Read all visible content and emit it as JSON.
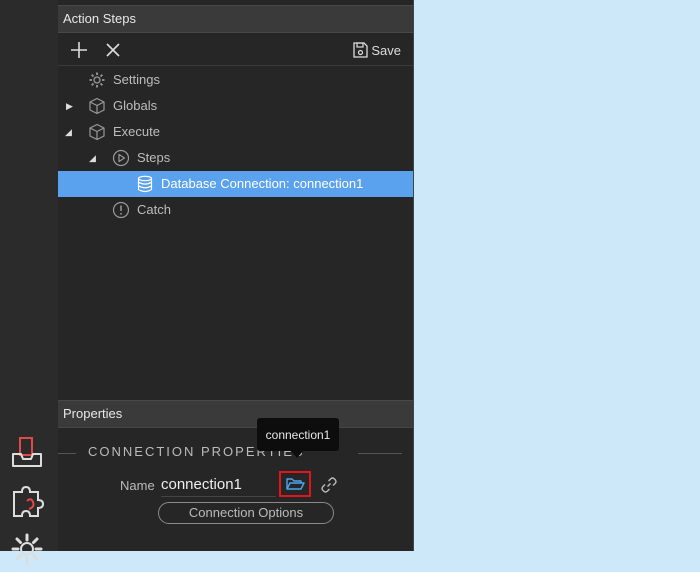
{
  "action_steps_panel": {
    "title": "Action Steps",
    "toolbar": {
      "add_icon": "plus-icon",
      "remove_icon": "close-icon",
      "save_label": "Save"
    },
    "tree": [
      {
        "label": "Settings",
        "icon": "gear-icon",
        "expander": ""
      },
      {
        "label": "Globals",
        "icon": "cube-icon",
        "expander": "▶"
      },
      {
        "label": "Execute",
        "icon": "cube-icon",
        "expander": "◢"
      },
      {
        "label": "Steps",
        "icon": "play-circle-icon",
        "expander": "◢"
      },
      {
        "label": "Database Connection: connection1",
        "icon": "database-icon",
        "expander": "",
        "selected": true
      },
      {
        "label": "Catch",
        "icon": "exclamation-circle-icon",
        "expander": ""
      }
    ]
  },
  "properties_panel": {
    "title": "Properties",
    "section_title": "CONNECTION PROPERTIES",
    "name_label": "Name",
    "name_value": "connection1",
    "folder_button_icon": "folder-open-icon",
    "link_button_icon": "link-icon",
    "connection_options_label": "Connection Options"
  },
  "tooltip": {
    "text": "connection1"
  },
  "colors": {
    "selection": "#5aa1ee",
    "highlight_border": "#e0161c",
    "desktop_background": "#cce8f9"
  }
}
